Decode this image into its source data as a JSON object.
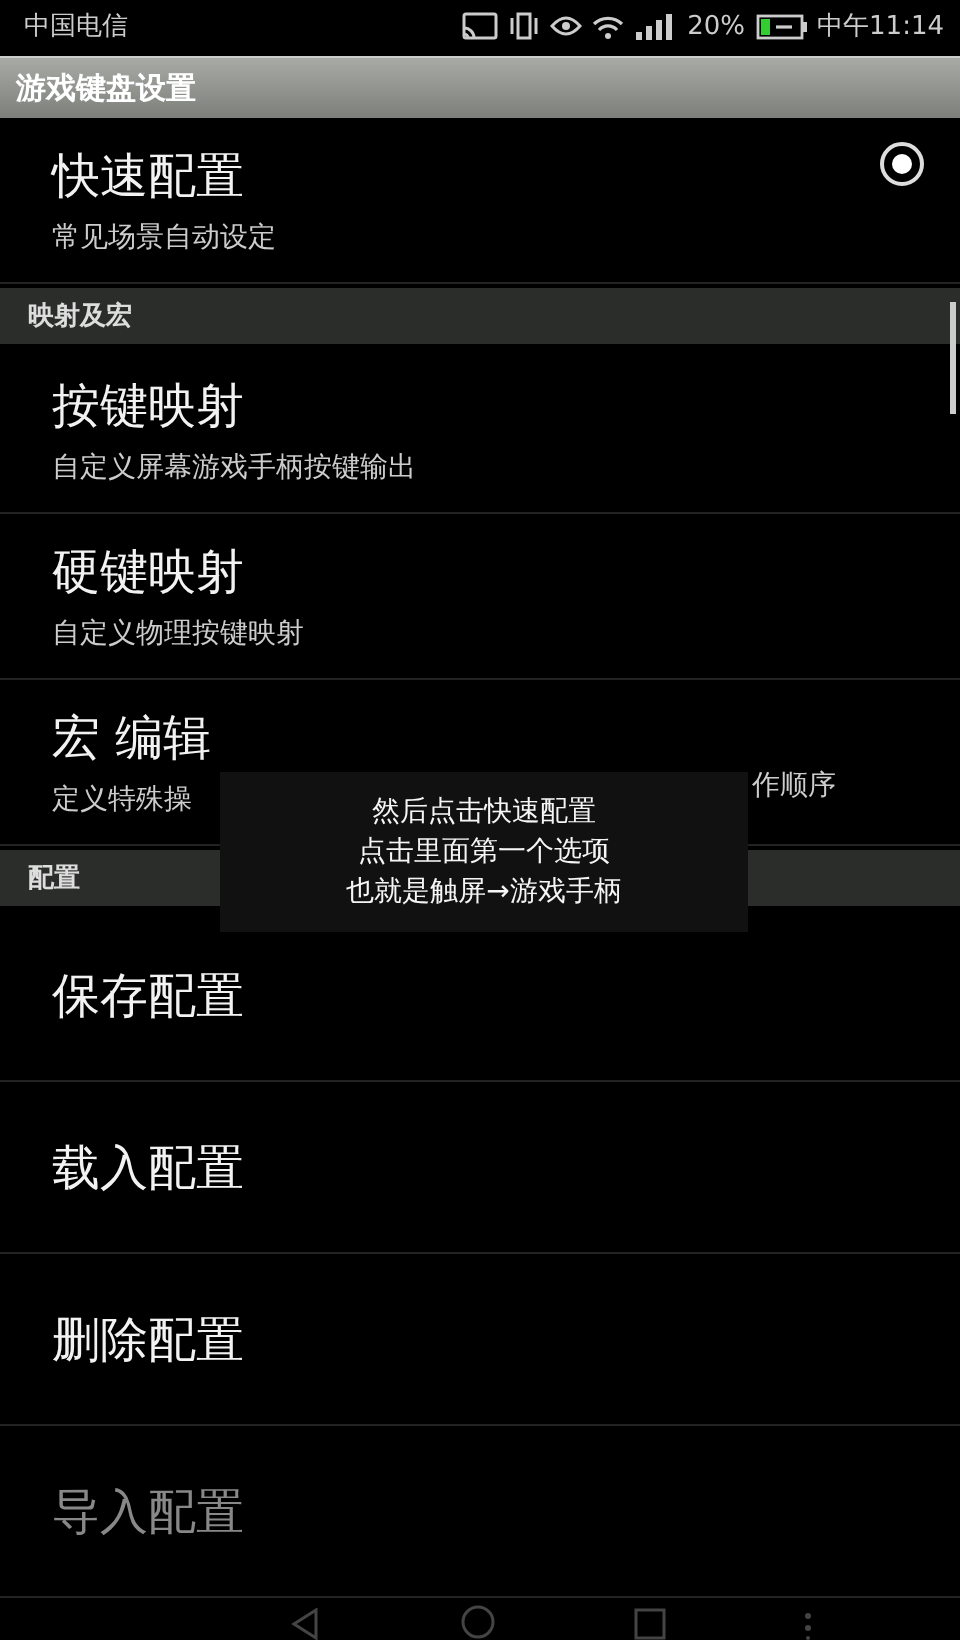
{
  "status_bar": {
    "carrier": "中国电信",
    "battery": "20%",
    "time": "中午11:14"
  },
  "title": "游戏键盘设置",
  "sections": [
    {
      "items": [
        {
          "title": "快速配置",
          "subtitle": "常见场景自动设定",
          "selected": true
        }
      ]
    },
    {
      "header": "映射及宏",
      "items": [
        {
          "title": "按键映射",
          "subtitle": "自定义屏幕游戏手柄按键输出"
        },
        {
          "title": "硬键映射",
          "subtitle": "自定义物理按键映射"
        },
        {
          "title": "宏 编辑",
          "subtitle": "定义特殊操",
          "subtitle_end": "作顺序"
        }
      ]
    },
    {
      "header": "配置",
      "items": [
        {
          "title": "保存配置"
        },
        {
          "title": "载入配置"
        },
        {
          "title": "删除配置"
        },
        {
          "title": "导入配置",
          "disabled": true
        }
      ]
    }
  ],
  "toast": [
    "然后点击快速配置",
    "点击里面第一个选项",
    "也就是触屏→游戏手柄"
  ]
}
